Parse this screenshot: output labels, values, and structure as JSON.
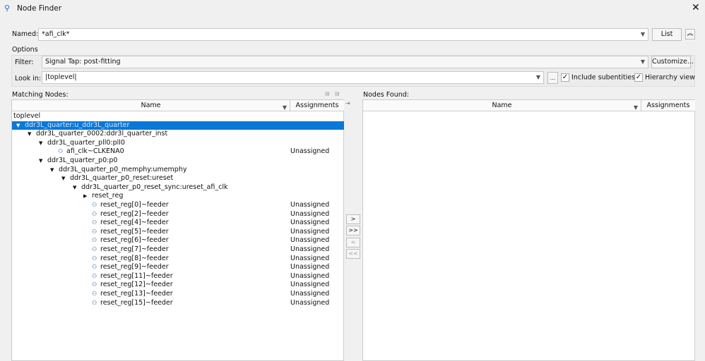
{
  "window": {
    "title": "Node Finder",
    "close_glyph": "✕"
  },
  "named": {
    "label": "Named:",
    "value": "*afi_clk*",
    "list_button": "List",
    "collapse_glyph": "︽"
  },
  "options": {
    "label": "Options",
    "filter_label": "Filter:",
    "filter_value": "Signal Tap: post-fitting",
    "customize_button": "Customize...",
    "lookin_label": "Look in:",
    "lookin_value": "|toplevel|",
    "browse_button": "...",
    "include_subentities": {
      "label": "Include subentities",
      "checked": true
    },
    "hierarchy_view": {
      "label": "Hierarchy view",
      "checked": true
    }
  },
  "matching": {
    "label": "Matching Nodes:",
    "col_name": "Name",
    "col_assign": "Assignments",
    "rows": [
      {
        "text": "toplevel",
        "assign": ""
      },
      {
        "text": "ddr3L_quarter:u_ddr3L_quarter",
        "assign": ""
      },
      {
        "text": "ddr3L_quarter_0002:ddr3l_quarter_inst",
        "assign": ""
      },
      {
        "text": "ddr3L_quarter_pll0:pll0",
        "assign": ""
      },
      {
        "text": "afi_clk~CLKENA0",
        "assign": "Unassigned"
      },
      {
        "text": "ddr3L_quarter_p0:p0",
        "assign": ""
      },
      {
        "text": "ddr3L_quarter_p0_memphy:umemphy",
        "assign": ""
      },
      {
        "text": "ddr3L_quarter_p0_reset:ureset",
        "assign": ""
      },
      {
        "text": "ddr3L_quarter_p0_reset_sync:ureset_afi_clk",
        "assign": ""
      },
      {
        "text": "reset_reg",
        "assign": ""
      },
      {
        "text": "reset_reg[0]~feeder",
        "assign": "Unassigned"
      },
      {
        "text": "reset_reg[2]~feeder",
        "assign": "Unassigned"
      },
      {
        "text": "reset_reg[4]~feeder",
        "assign": "Unassigned"
      },
      {
        "text": "reset_reg[5]~feeder",
        "assign": "Unassigned"
      },
      {
        "text": "reset_reg[6]~feeder",
        "assign": "Unassigned"
      },
      {
        "text": "reset_reg[7]~feeder",
        "assign": "Unassigned"
      },
      {
        "text": "reset_reg[8]~feeder",
        "assign": "Unassigned"
      },
      {
        "text": "reset_reg[9]~feeder",
        "assign": "Unassigned"
      },
      {
        "text": "reset_reg[11]~feeder",
        "assign": "Unassigned"
      },
      {
        "text": "reset_reg[12]~feeder",
        "assign": "Unassigned"
      },
      {
        "text": "reset_reg[13]~feeder",
        "assign": "Unassigned"
      },
      {
        "text": "reset_reg[15]~feeder",
        "assign": "Unassigned"
      }
    ]
  },
  "move": {
    "add": ">",
    "add_all": ">>",
    "remove": "<",
    "remove_all": "<<"
  },
  "found": {
    "label": "Nodes Found:",
    "col_name": "Name",
    "col_assign": "Assignments"
  },
  "colors": {
    "selection": "#0a78d7"
  }
}
